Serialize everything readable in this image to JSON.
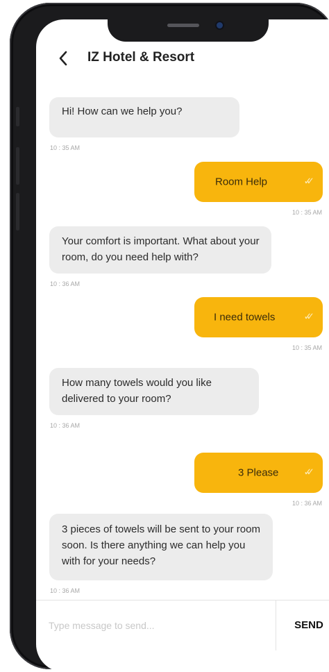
{
  "header": {
    "back_icon": "chevron-left-icon",
    "back_glyph": "‹",
    "title": "IZ Hotel & Resort"
  },
  "messages": [
    {
      "side": "in",
      "text": "Hi! How can we help you?",
      "time": "10 : 35 AM"
    },
    {
      "side": "out",
      "text": "Room Help",
      "time": "10 : 35 AM",
      "status_icon": "double-check-icon"
    },
    {
      "side": "in",
      "text": "Your comfort is important. What about your room, do you need help with?",
      "time": "10 : 36 AM"
    },
    {
      "side": "out",
      "text": "I need towels",
      "time": "10 : 35 AM",
      "status_icon": "double-check-icon"
    },
    {
      "side": "in",
      "text": "How many towels would you like delivered to your room?",
      "time": "10 : 36 AM"
    },
    {
      "side": "out",
      "text": "3 Please",
      "time": "10 : 36 AM",
      "status_icon": "double-check-icon"
    },
    {
      "side": "in",
      "text": "3 pieces of towels will be sent to your room soon. Is there anything we can help you with for your needs?",
      "time": "10 : 36 AM"
    }
  ],
  "composer": {
    "placeholder": "Type message to send...",
    "value": "",
    "send_label": "SEND"
  },
  "colors": {
    "accent": "#f8b50d",
    "incoming_bubble": "#ececec",
    "check_mark": "#fdeab3"
  }
}
